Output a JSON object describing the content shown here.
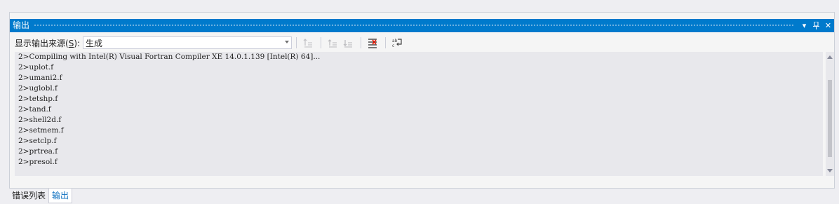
{
  "window": {
    "title": "输出",
    "pin_glyph": "⊥",
    "close_glyph": "✕",
    "dropdown_glyph": "▾"
  },
  "toolbar": {
    "source_label_prefix": "显示输出来源(",
    "source_label_key": "S",
    "source_label_suffix": "):",
    "source_selected": "生成"
  },
  "output_lines": [
    "2>Compiling with Intel(R) Visual Fortran Compiler XE 14.0.1.139 [Intel(R) 64]...",
    "2>uplot.f",
    "2>umani2.f",
    "2>uglobl.f",
    "2>tetshp.f",
    "2>tand.f",
    "2>shell2d.f",
    "2>setmem.f",
    "2>setclp.f",
    "2>prtrea.f",
    "2>presol.f"
  ],
  "tabs": [
    {
      "label": "错误列表",
      "active": false
    },
    {
      "label": "输出",
      "active": true
    }
  ],
  "colors": {
    "accent": "#007acc",
    "active_tab_text": "#0e70c0",
    "content_bg": "#e8e8ec"
  }
}
